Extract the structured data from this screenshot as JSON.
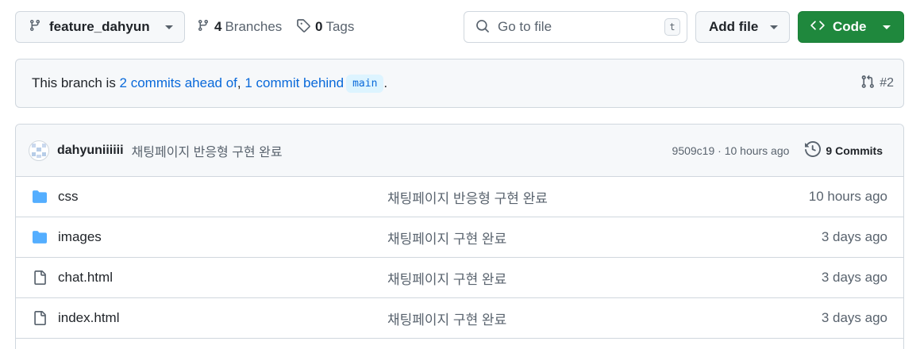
{
  "toolbar": {
    "branch": "feature_dahyun",
    "branches_count": "4",
    "branches_label": "Branches",
    "tags_count": "0",
    "tags_label": "Tags",
    "search_placeholder": "Go to file",
    "search_shortcut": "t",
    "add_file_label": "Add file",
    "code_label": "Code"
  },
  "banner": {
    "prefix": "This branch is ",
    "ahead": "2 commits ahead of",
    "comma": ", ",
    "behind": "1 commit behind",
    "base_branch": "main",
    "suffix": ".",
    "pr_number": "#2"
  },
  "latest_commit": {
    "author": "dahyuniiiiii",
    "message": "채팅페이지 반응형 구현 완료",
    "sha_time": "9509c19 · 10 hours ago",
    "commits_label": "9 Commits"
  },
  "files": [
    {
      "icon": "folder-icon",
      "name": "css",
      "message": "채팅페이지 반응형 구현 완료",
      "time": "10 hours ago"
    },
    {
      "icon": "folder-icon",
      "name": "images",
      "message": "채팅페이지 구현 완료",
      "time": "3 days ago"
    },
    {
      "icon": "file-icon",
      "name": "chat.html",
      "message": "채팅페이지 구현 완료",
      "time": "3 days ago"
    },
    {
      "icon": "file-icon",
      "name": "index.html",
      "message": "채팅페이지 구현 완료",
      "time": "3 days ago"
    }
  ],
  "colors": {
    "accent": "#0969da",
    "primary_button": "#1f883d",
    "folder": "#54aeff",
    "border": "#d0d7de"
  }
}
